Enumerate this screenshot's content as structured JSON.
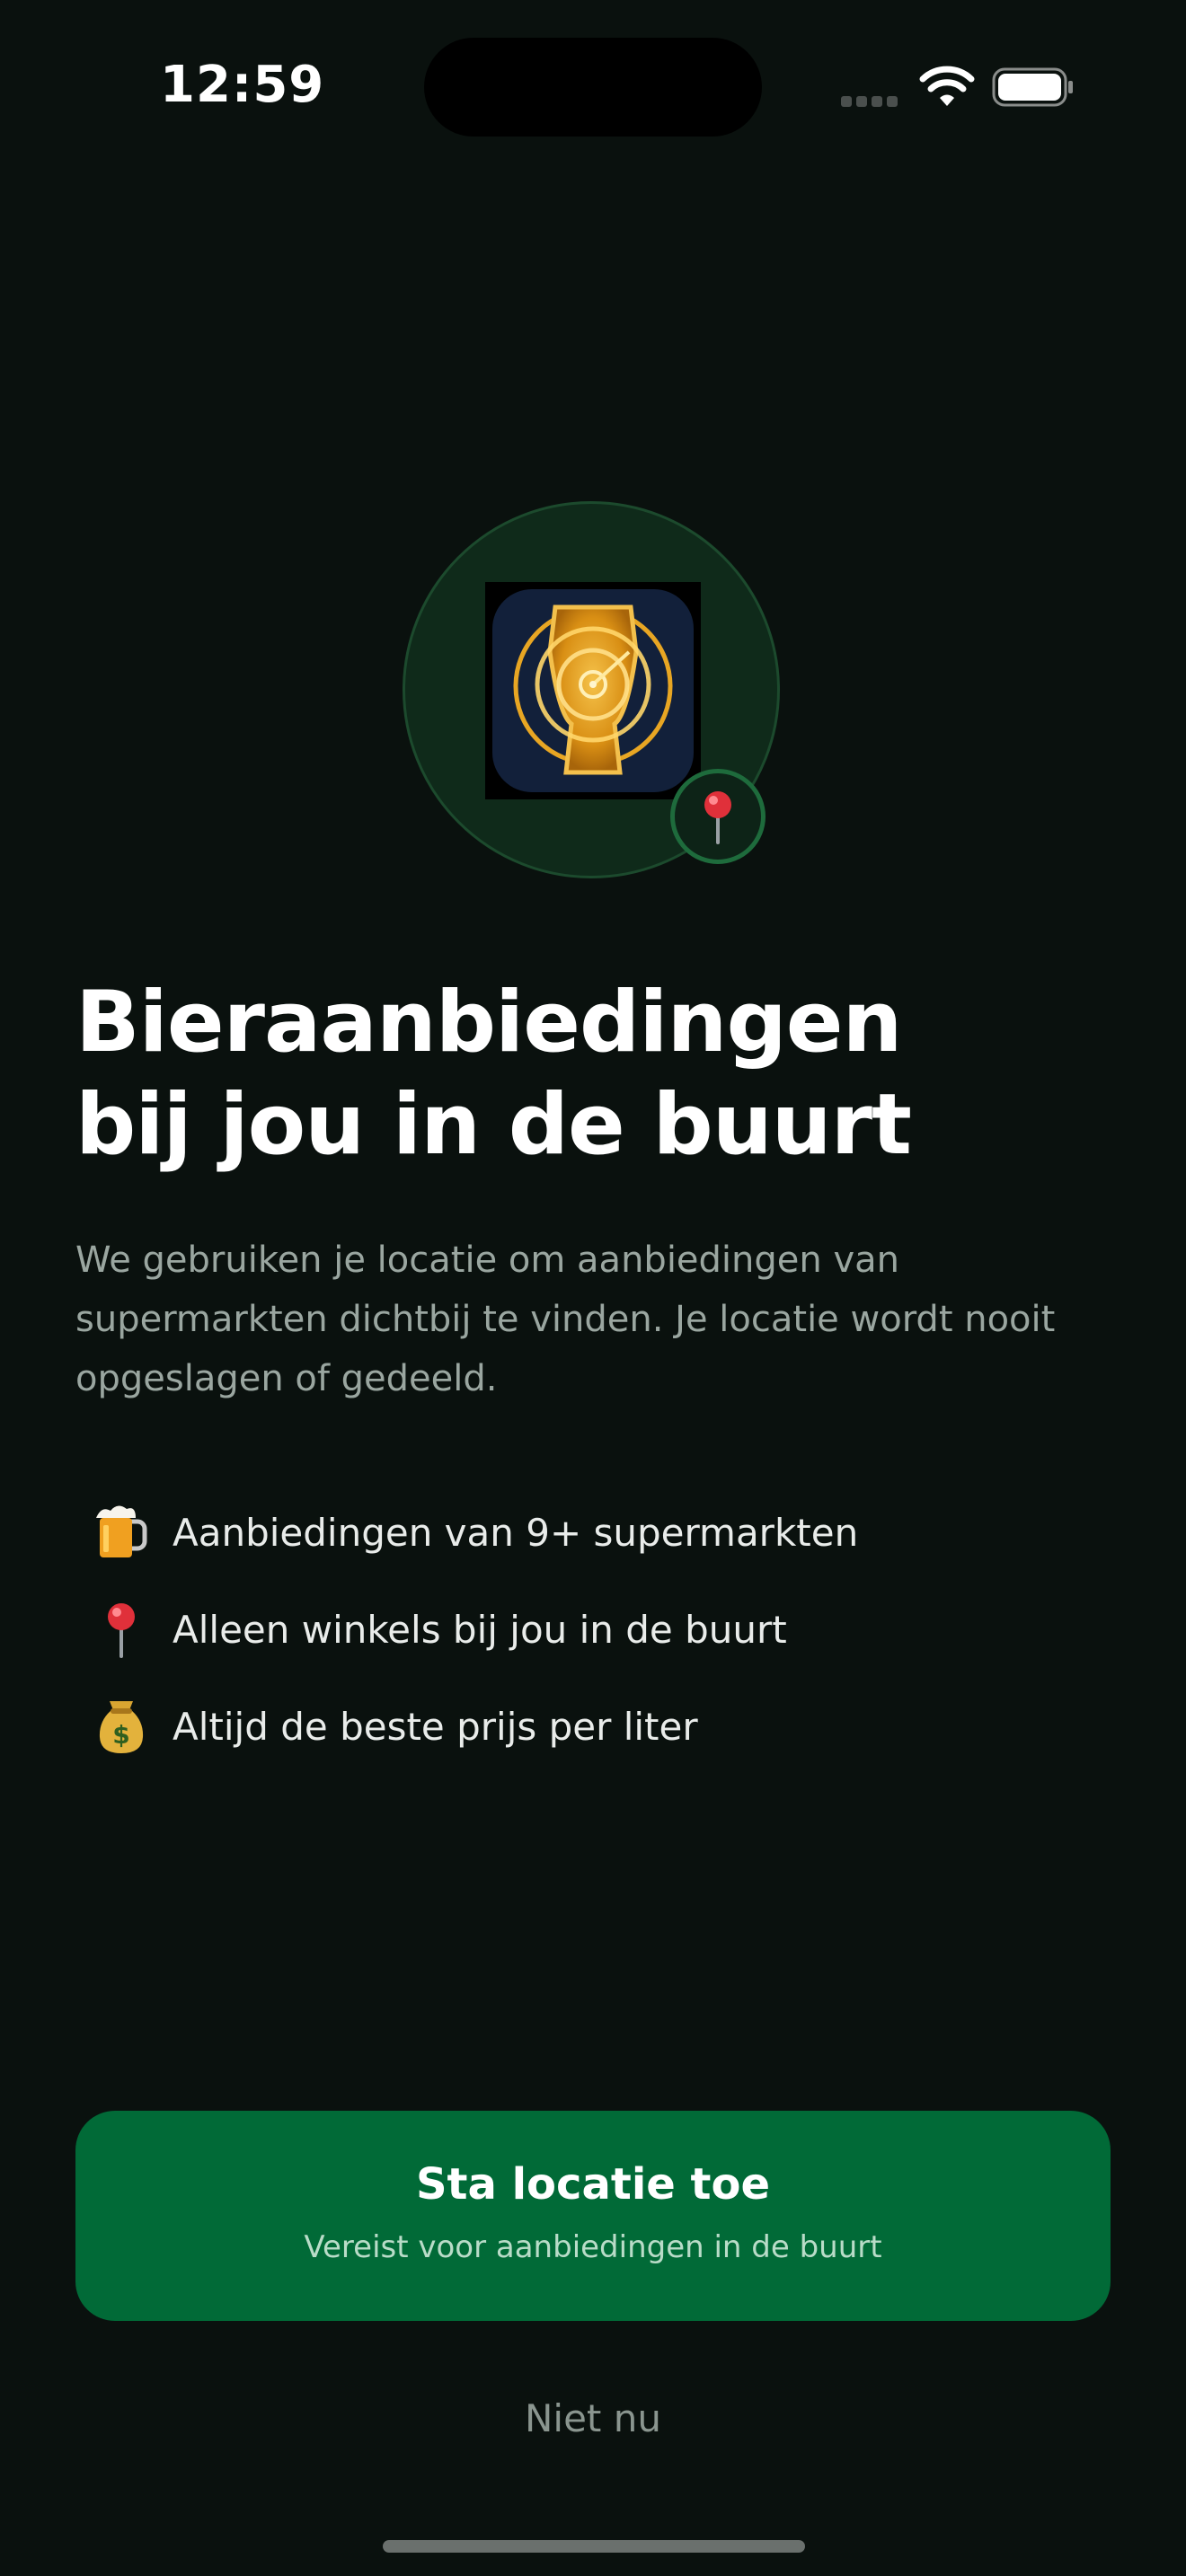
{
  "status_bar": {
    "time": "12:59"
  },
  "hero": {
    "app_icon": "beer-radar-app-icon",
    "badge_icon": "pushpin-icon"
  },
  "content": {
    "title_line_1": "Bieraanbiedingen",
    "title_line_2": "bij jou in de buurt",
    "description": "We gebruiken je locatie om aanbiedingen van supermarkten dichtbij te vinden. Je locatie wordt nooit opgeslagen of gedeeld."
  },
  "features": [
    {
      "icon": "beer-mug-icon",
      "label": "Aanbiedingen van 9+ supermarkten"
    },
    {
      "icon": "pushpin-icon",
      "label": "Alleen winkels bij jou in de buurt"
    },
    {
      "icon": "money-bag-icon",
      "label": "Altijd de beste prijs per liter"
    }
  ],
  "actions": {
    "allow_label": "Sta locatie toe",
    "allow_sublabel": "Vereist voor aanbiedingen in de buurt",
    "skip_label": "Niet nu"
  },
  "colors": {
    "background": "#0a110e",
    "primary_button": "#016a37",
    "accent_gold": "#e8a623"
  }
}
